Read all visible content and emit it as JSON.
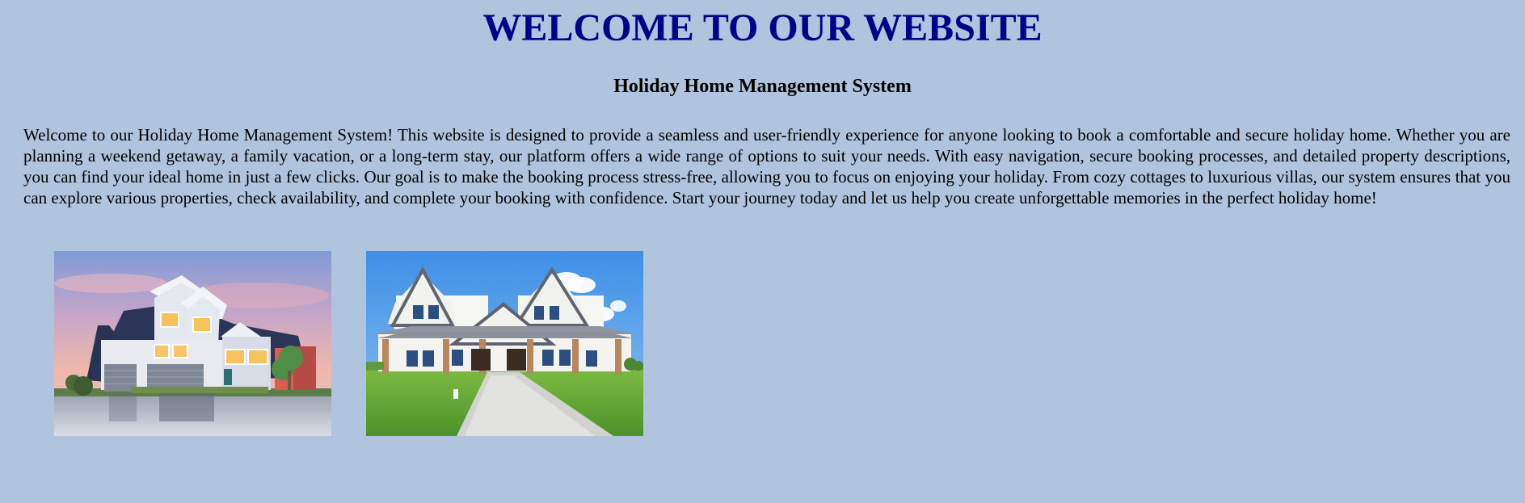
{
  "page": {
    "title": "WELCOME TO OUR WEBSITE",
    "subtitle": "Holiday Home Management System",
    "description": "Welcome to our Holiday Home Management System! This website is designed to provide a seamless and user-friendly experience for anyone looking to book a comfortable and secure holiday home. Whether you are planning a weekend getaway, a family vacation, or a long-term stay, our platform offers a wide range of options to suit your needs. With easy navigation, secure booking processes, and detailed property descriptions, you can find your ideal home in just a few clicks. Our goal is to make the booking process stress-free, allowing you to focus on enjoying your holiday. From cozy cottages to luxurious villas, our system ensures that you can explore various properties, check availability, and complete your booking with confidence. Start your journey today and let us help you create unforgettable memories in the perfect holiday home!"
  },
  "colors": {
    "background": "#b0c4de",
    "title": "#00008b",
    "text": "#000000"
  },
  "gallery": {
    "images": [
      {
        "icon": "house-photo-dusk"
      },
      {
        "icon": "house-photo-farmhouse"
      }
    ]
  }
}
